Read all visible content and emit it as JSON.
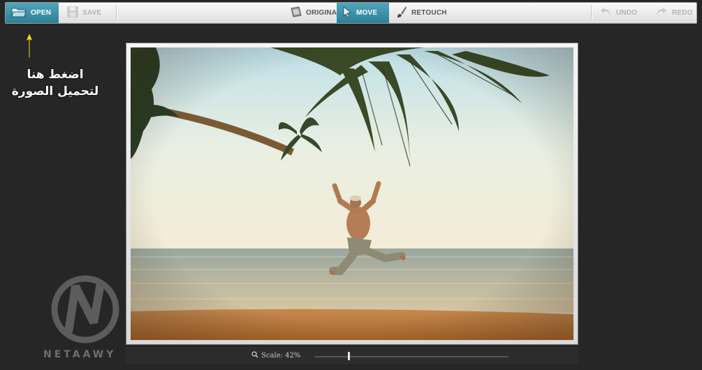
{
  "toolbar": {
    "open_label": "OPEN",
    "save_label": "SAVE",
    "original_label": "ORIGINAL",
    "move_label": "MOVE",
    "retouch_label": "RETOUCH",
    "undo_label": "UNDO",
    "redo_label": "REDO"
  },
  "annotation": {
    "line1": "اضغط هنا",
    "line2": "لتحميل الصورة",
    "arrow_color": "#ffe600"
  },
  "scale": {
    "label": "Scale: 42%",
    "value_percent": 42
  },
  "watermark": {
    "text": "NETAAWY"
  },
  "colors": {
    "accent": "#3a93ab",
    "background": "#262626"
  }
}
